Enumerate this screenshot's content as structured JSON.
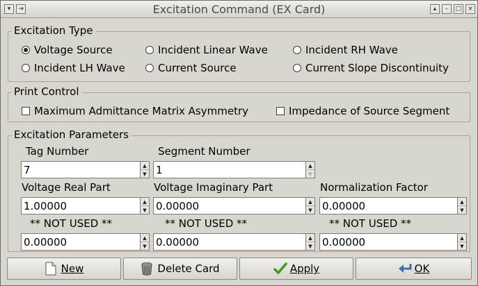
{
  "window": {
    "title": "Excitation Command (EX Card)",
    "controls_left": [
      "menu-icon",
      "pin-icon"
    ],
    "controls_right": [
      "shade-icon",
      "minimize-icon",
      "maximize-icon",
      "close-icon"
    ]
  },
  "excitation_type": {
    "title": "Excitation Type",
    "options": [
      {
        "label": "Voltage Source",
        "selected": true
      },
      {
        "label": "Incident Linear Wave",
        "selected": false
      },
      {
        "label": "Incident RH Wave",
        "selected": false
      },
      {
        "label": "Incident LH Wave",
        "selected": false
      },
      {
        "label": "Current Source",
        "selected": false
      },
      {
        "label": "Current Slope Discontinuity",
        "selected": false
      }
    ]
  },
  "print_control": {
    "title": "Print Control",
    "options": [
      {
        "label": "Maximum Admittance Matrix Asymmetry",
        "checked": false
      },
      {
        "label": "Impedance of Source Segment",
        "checked": false
      }
    ]
  },
  "parameters": {
    "title": "Excitation Parameters",
    "tag_number": {
      "label": "Tag Number",
      "value": "7"
    },
    "segment_number": {
      "label": "Segment Number",
      "value": "1"
    },
    "voltage_real": {
      "label": "Voltage Real Part",
      "value": "1.00000"
    },
    "voltage_imag": {
      "label": "Voltage Imaginary Part",
      "value": "0.00000"
    },
    "normalization": {
      "label": "Normalization Factor",
      "value": "0.00000"
    },
    "unused1": {
      "label": "** NOT USED **",
      "value": "0.00000"
    },
    "unused2": {
      "label": "** NOT USED **",
      "value": "0.00000"
    },
    "unused3": {
      "label": "** NOT USED **",
      "value": "0.00000"
    }
  },
  "buttons": {
    "new": {
      "label": "New",
      "icon": "new-document-icon"
    },
    "delete": {
      "label": "Delete Card",
      "icon": "trash-icon"
    },
    "apply": {
      "label": "Apply",
      "icon": "checkmark-icon"
    },
    "ok": {
      "label": "OK",
      "icon": "return-arrow-icon"
    }
  }
}
